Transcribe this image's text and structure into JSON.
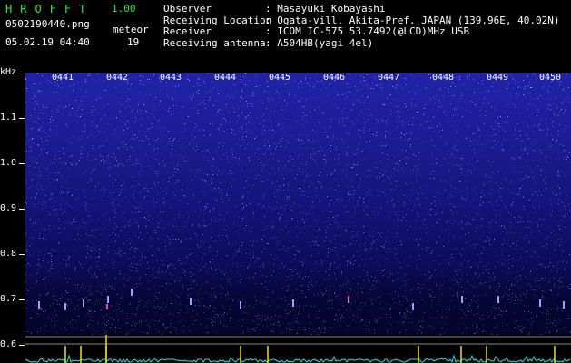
{
  "app": {
    "name": "HROFFT",
    "version": "1.00"
  },
  "file": {
    "name": "0502190440.png",
    "datetime": "05.02.19 04:40"
  },
  "meteor": {
    "label": "meteor",
    "count": "19"
  },
  "info": [
    {
      "key": "Observer",
      "value": ": Masayuki Kobayashi"
    },
    {
      "key": "Receiving Location",
      "value": ": Ogata-vill. Akita-Pref. JAPAN (139.96E, 40.02N)"
    },
    {
      "key": "Receiver",
      "value": ": ICOM IC-575 53.7492(@LCD)MHz USB"
    },
    {
      "key": "Receiving antenna",
      "value": ": A504HB(yagi 4el)"
    }
  ],
  "axis": {
    "unit": "kHz",
    "freq_labels": [
      "1.1",
      "1.0",
      "0.9",
      "0.8",
      "0.7",
      "0.6"
    ],
    "time_labels": [
      "0441",
      "0442",
      "0443",
      "0444",
      "0445",
      "0446",
      "0447",
      "0448",
      "0449",
      "0450"
    ]
  },
  "colors": {
    "title_green": "#2ee64a",
    "spectrum_blue": "#2222a8",
    "trace_cyan": "#22e0e0",
    "peak_yellow": "#f0e010"
  }
}
